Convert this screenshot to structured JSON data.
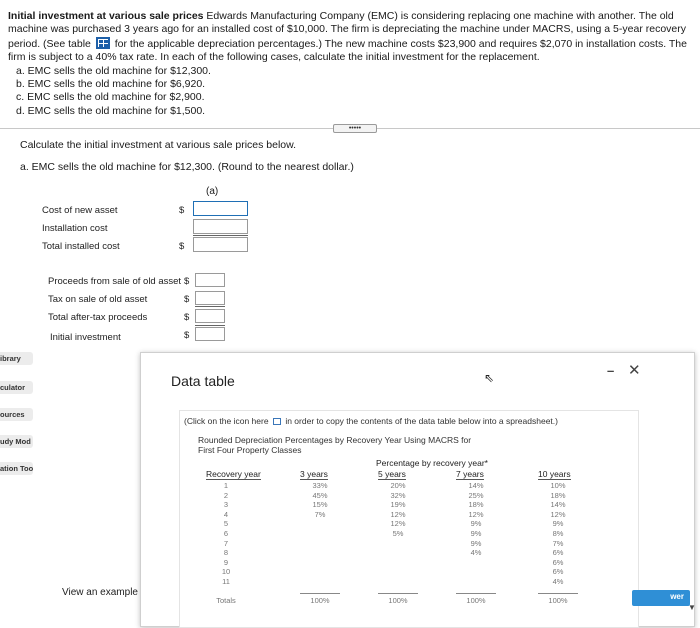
{
  "problem": {
    "title": "Initial investment at various sale prices",
    "text_a": "Edwards Manufacturing Company (EMC) is considering replacing one machine with another. The old machine was purchased 3 years ago for an installed cost of $10,000. The firm is depreciating the machine under MACRS, using a 5-year recovery period. (See table",
    "text_b": "for the applicable depreciation percentages.) The new machine costs $23,900 and requires $2,070 in installation costs. The firm is subject to a 40% tax rate. In each of the following cases, calculate the initial investment for the replacement.",
    "cases": [
      "a. EMC sells the old machine for $12,300.",
      "b. EMC sells the old machine for $6,920.",
      "c. EMC sells the old machine for $2,900.",
      "d. EMC sells the old machine for $1,500."
    ]
  },
  "expand_label": "•••••",
  "instruction": "Calculate the initial investment at various sale prices below.",
  "subquestion": "a. EMC sells the old machine for $12,300. (Round to the nearest dollar.)",
  "column_a": "(a)",
  "currency": "$",
  "rows_top": [
    "Cost of new asset",
    "Installation cost",
    "Total installed cost"
  ],
  "rows_bottom": [
    "Proceeds from sale of old asset",
    "Tax on sale of old asset",
    "Total after-tax proceeds",
    "Initial investment"
  ],
  "sidebar": [
    "ibrary",
    "culator",
    "ources",
    "udy Mod",
    "ation Too"
  ],
  "panel": {
    "title": "Data table",
    "minimize": "–",
    "close": "✕",
    "click_note_a": "(Click on the icon here",
    "click_note_b": "in order to copy the contents of the data table below into a spreadsheet.)",
    "heading_1": "Rounded Depreciation Percentages by Recovery Year Using MACRS for",
    "heading_2": "First Four Property Classes",
    "pct_header": "Percentage by recovery year*",
    "recovery_year": "Recovery year",
    "classes": [
      "3 years",
      "5 years",
      "7 years",
      "10 years"
    ],
    "years": [
      "1",
      "2",
      "3",
      "4",
      "5",
      "6",
      "7",
      "8",
      "9",
      "10",
      "11"
    ],
    "totals_label": "Totals",
    "col_3": [
      "33%",
      "45%",
      "15%",
      "7%"
    ],
    "col_5": [
      "20%",
      "32%",
      "19%",
      "12%",
      "12%",
      "5%"
    ],
    "col_7": [
      "14%",
      "25%",
      "18%",
      "12%",
      "9%",
      "9%",
      "9%",
      "4%"
    ],
    "col_10": [
      "10%",
      "18%",
      "14%",
      "12%",
      "9%",
      "8%",
      "7%",
      "6%",
      "6%",
      "6%",
      "4%"
    ],
    "totals": [
      "100%",
      "100%",
      "100%",
      "100%"
    ]
  },
  "view_example": "View an example",
  "answer_btn": "wer"
}
